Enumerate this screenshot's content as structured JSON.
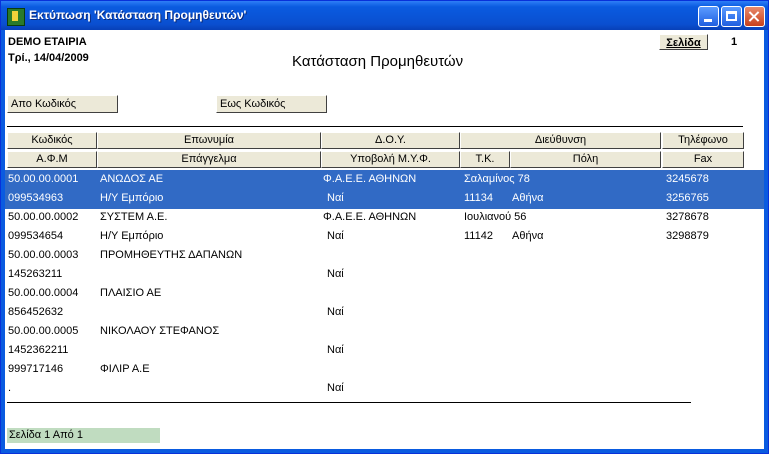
{
  "window": {
    "title": "Εκτύπωση 'Κατάσταση Προμηθευτών'"
  },
  "report": {
    "company": "DEMO ΕΤΑΙΡΙΑ",
    "date": "Τρί., 14/04/2009",
    "title": "Κατάσταση Προμηθευτών",
    "page_button": "Σελίδα",
    "page_number": "1"
  },
  "filters": {
    "from_label": "Απο Κωδικός",
    "to_label": "Εως Κωδικός"
  },
  "columns": {
    "row1": [
      "Κωδικός",
      "Επωνυμία",
      "Δ.Ο.Υ.",
      "Διεύθυνση",
      "Τηλέφωνο"
    ],
    "row2": [
      "Α.Φ.Μ",
      "Επάγγελμα",
      "Υποβολή Μ.Υ.Φ.",
      "Τ.Κ.",
      "Πόλη",
      "Fax"
    ]
  },
  "records": [
    {
      "code": "50.00.00.0001",
      "name": "ΑΝΩΔΟΣ ΑΕ",
      "doy": "Φ.Α.Ε.Ε. ΑΘΗΝΩΝ",
      "address": "Σαλαμίνος 78",
      "phone": "3245678",
      "afm": "099534963",
      "profession": "Η/Υ Εμπόριο",
      "myf": "Ναί",
      "tk": "11134",
      "city": "Αθήνα",
      "fax": "3256765",
      "selected": true
    },
    {
      "code": "50.00.00.0002",
      "name": "ΣΥΣΤΕΜ Α.Ε.",
      "doy": "Φ.Α.Ε.Ε. ΑΘΗΝΩΝ",
      "address": "Ιουλιανού 56",
      "phone": "3278678",
      "afm": "099534654",
      "profession": "Η/Υ Εμπόριο",
      "myf": "Ναί",
      "tk": "11142",
      "city": "Αθήνα",
      "fax": "3298879",
      "selected": false
    },
    {
      "code": "50.00.00.0003",
      "name": "ΠΡΟΜΗΘΕΥΤΗΣ ΔΑΠΑΝΩΝ",
      "doy": "",
      "address": "",
      "phone": "",
      "afm": "145263211",
      "profession": "",
      "myf": "Ναί",
      "tk": "",
      "city": "",
      "fax": "",
      "selected": false
    },
    {
      "code": "50.00.00.0004",
      "name": "ΠΛΑΙΣΙΟ ΑΕ",
      "doy": "",
      "address": "",
      "phone": "",
      "afm": "856452632",
      "profession": "",
      "myf": "Ναί",
      "tk": "",
      "city": "",
      "fax": "",
      "selected": false
    },
    {
      "code": "50.00.00.0005",
      "name": "ΝΙΚΟΛΑΟΥ ΣΤΕΦΑΝΟΣ",
      "doy": "",
      "address": "",
      "phone": "",
      "afm": "1452362211",
      "profession": "",
      "myf": "Ναί",
      "tk": "",
      "city": "",
      "fax": "",
      "selected": false
    },
    {
      "code": "999717146",
      "name": "ΦΙΛΙΡ Α.Ε",
      "doy": "",
      "address": "",
      "phone": "",
      "afm": ".",
      "profession": "",
      "myf": "Ναί",
      "tk": "",
      "city": "",
      "fax": "",
      "selected": false
    }
  ],
  "status": {
    "page_info": "Σελίδα 1 Από 1"
  },
  "colors": {
    "title_bar": "#0a5be0",
    "selection": "#316ac5",
    "header_bg": "#ece9d8",
    "status_bg": "#c0dcc0"
  }
}
